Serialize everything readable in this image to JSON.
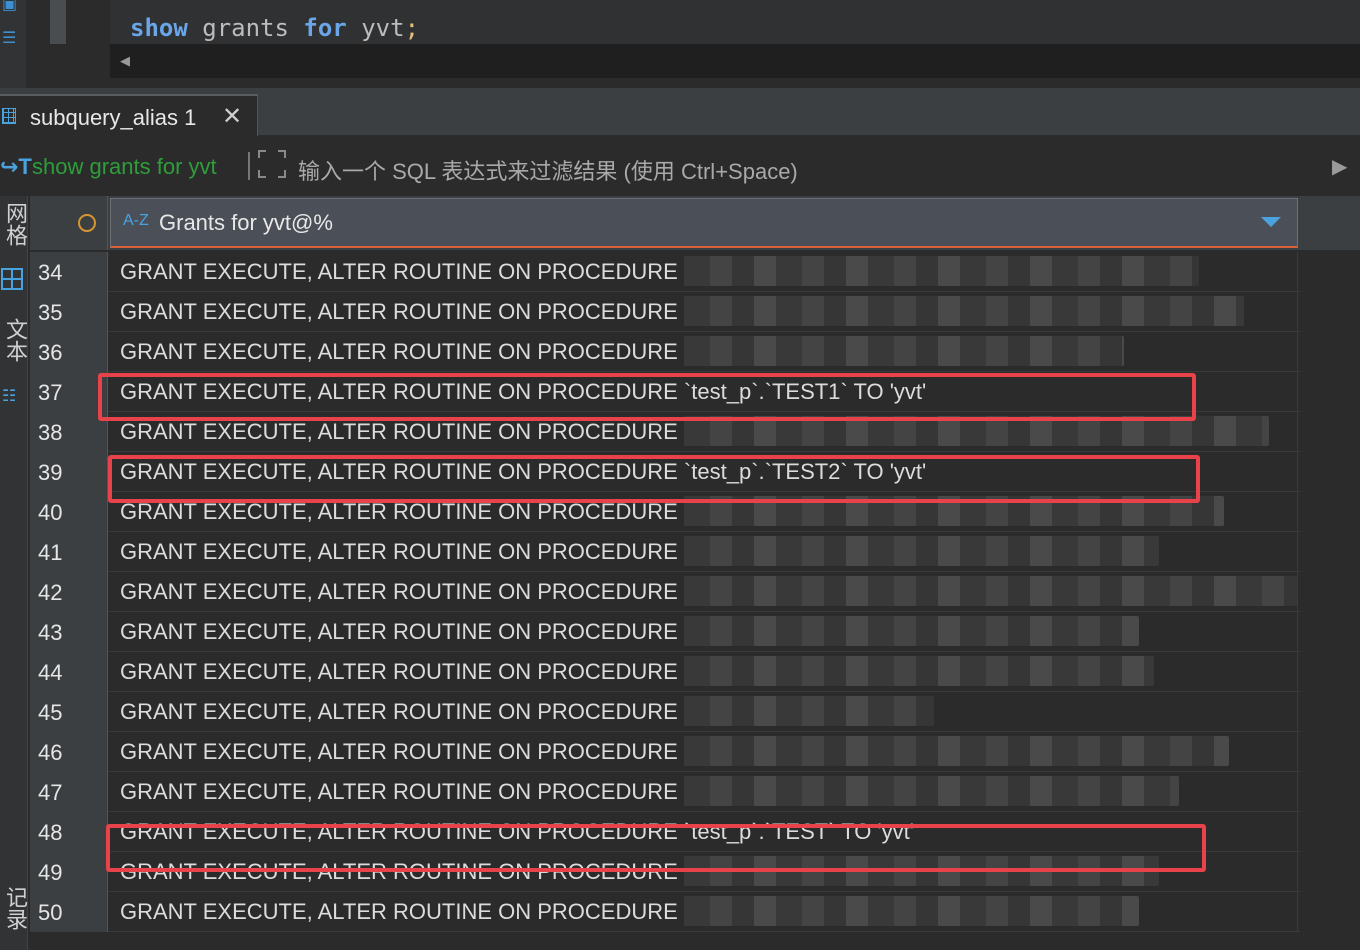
{
  "editor": {
    "code": {
      "kw1": "show",
      "w1": "grants",
      "kw2": "for",
      "w2": "yvt",
      "end": ";"
    }
  },
  "tab": {
    "label": "subquery_alias 1",
    "close": "✕"
  },
  "filter": {
    "query_label": "show grants for yvt",
    "placeholder": "输入一个 SQL 表达式来过滤结果 (使用 Ctrl+Space)"
  },
  "side_panel": {
    "grid_tab": "网格",
    "text_tab": "文本",
    "record_tab": "记录"
  },
  "grid": {
    "column_title": "Grants for yvt@%",
    "az_label": "A-Z",
    "rows": [
      {
        "num": "34",
        "text": "GRANT EXECUTE, ALTER ROUTINE ON PROCEDURE",
        "redacted": true
      },
      {
        "num": "35",
        "text": "GRANT EXECUTE, ALTER ROUTINE ON PROCEDURE",
        "redacted": true
      },
      {
        "num": "36",
        "text": "GRANT EXECUTE, ALTER ROUTINE ON PROCEDURE",
        "redacted": true
      },
      {
        "num": "37",
        "text": "GRANT EXECUTE, ALTER ROUTINE ON PROCEDURE `test_p`.`TEST1` TO 'yvt'",
        "redacted": false,
        "highlighted": true
      },
      {
        "num": "38",
        "text": "GRANT EXECUTE, ALTER ROUTINE ON PROCEDURE",
        "redacted": true
      },
      {
        "num": "39",
        "text": "GRANT EXECUTE, ALTER ROUTINE ON PROCEDURE `test_p`.`TEST2` TO 'yvt'",
        "redacted": false,
        "highlighted": true
      },
      {
        "num": "40",
        "text": "GRANT EXECUTE, ALTER ROUTINE ON PROCEDURE",
        "redacted": true
      },
      {
        "num": "41",
        "text": "GRANT EXECUTE, ALTER ROUTINE ON PROCEDURE",
        "redacted": true
      },
      {
        "num": "42",
        "text": "GRANT EXECUTE, ALTER ROUTINE ON PROCEDURE",
        "redacted": true
      },
      {
        "num": "43",
        "text": "GRANT EXECUTE, ALTER ROUTINE ON PROCEDURE",
        "redacted": true
      },
      {
        "num": "44",
        "text": "GRANT EXECUTE, ALTER ROUTINE ON PROCEDURE",
        "redacted": true
      },
      {
        "num": "45",
        "text": "GRANT EXECUTE, ALTER ROUTINE ON PROCEDURE",
        "redacted": true
      },
      {
        "num": "46",
        "text": "GRANT EXECUTE, ALTER ROUTINE ON PROCEDURE",
        "redacted": true
      },
      {
        "num": "47",
        "text": "GRANT EXECUTE, ALTER ROUTINE ON PROCEDURE",
        "redacted": true
      },
      {
        "num": "48",
        "text": "GRANT EXECUTE, ALTER ROUTINE ON PROCEDURE `test_p`.`TEST` TO 'yvt'",
        "redacted": false,
        "highlighted": true
      },
      {
        "num": "49",
        "text": "GRANT EXECUTE, ALTER ROUTINE ON PROCEDURE",
        "redacted": true
      },
      {
        "num": "50",
        "text": "GRANT EXECUTE, ALTER ROUTINE ON PROCEDURE",
        "redacted": true
      }
    ]
  },
  "colors": {
    "highlight": "#e8434b",
    "accent": "#4aa3df",
    "query_green": "#2e9e3b"
  }
}
